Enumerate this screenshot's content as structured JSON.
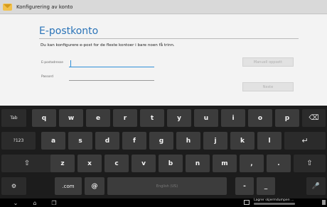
{
  "window": {
    "title": "Konfigurering av konto"
  },
  "form": {
    "heading": "E-postkonto",
    "description": "Du kan konfigurere e-post for de fleste kontoer i bare noen få trinn.",
    "email_label": "E-postadresse",
    "password_label": "Passord",
    "email_value": "",
    "password_value": "",
    "manual_setup_label": "Manuell oppsett",
    "next_label": "Neste"
  },
  "keyboard": {
    "row1": [
      "Tab",
      "q",
      "w",
      "e",
      "r",
      "t",
      "y",
      "u",
      "i",
      "o",
      "p",
      "backspace"
    ],
    "row2": [
      "?123",
      "a",
      "s",
      "d",
      "f",
      "g",
      "h",
      "j",
      "k",
      "l",
      "enter"
    ],
    "row3": [
      "shift",
      "z",
      "x",
      "c",
      "v",
      "b",
      "n",
      "m",
      ",",
      ".",
      "shift"
    ],
    "row4": [
      "settings",
      ".com",
      "@",
      "English (US)",
      "-",
      "_",
      "mic"
    ],
    "tab_label": "Tab",
    "sym_label": "?123",
    "space_label": "English (US)",
    "dotcom_label": ".com",
    "at_label": "@",
    "dash_label": "-",
    "underscore_label": "_",
    "comma_label": ",",
    "period_label": "."
  },
  "navbar": {
    "buttons": [
      "back-icon",
      "home-icon",
      "recent-apps-icon"
    ],
    "notification": "Lagrer skjermdumpen ..."
  },
  "colors": {
    "accent": "#2b74b8",
    "keyboard_bg": "#1c1c1c",
    "key_bg": "#3c3c3c"
  }
}
